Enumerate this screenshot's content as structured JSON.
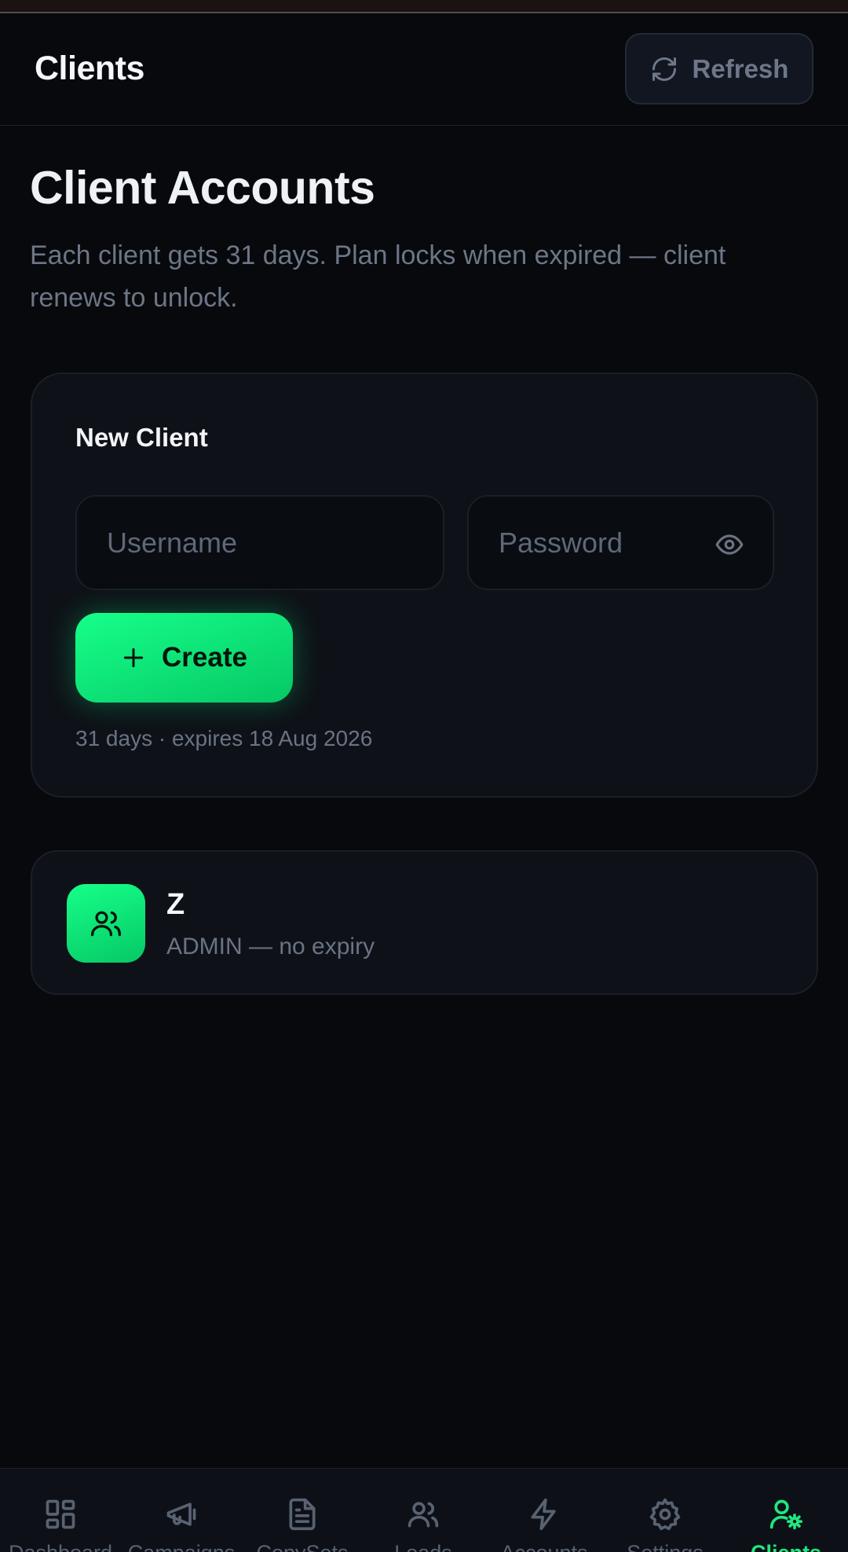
{
  "header": {
    "title": "Clients",
    "refresh_label": "Refresh"
  },
  "main": {
    "heading": "Client Accounts",
    "description": "Each client gets 31 days. Plan locks when expired — client renews to unlock."
  },
  "new_client": {
    "title": "New Client",
    "username_placeholder": "Username",
    "password_placeholder": "Password",
    "create_label": "Create",
    "meta": "31 days · expires 18 Aug 2026"
  },
  "clients": [
    {
      "name": "Z",
      "detail": "ADMIN — no expiry"
    }
  ],
  "nav": {
    "items": [
      {
        "label": "Dashboard",
        "icon": "dashboard-icon"
      },
      {
        "label": "Campaigns",
        "icon": "megaphone-icon"
      },
      {
        "label": "CopySets",
        "icon": "document-icon"
      },
      {
        "label": "Leads",
        "icon": "users-icon"
      },
      {
        "label": "Accounts",
        "icon": "lightning-icon"
      },
      {
        "label": "Settings",
        "icon": "gear-icon"
      },
      {
        "label": "Clients",
        "icon": "user-gear-icon",
        "active": true
      }
    ]
  },
  "colors": {
    "accent": "#1ee87f",
    "background": "#07090c",
    "card": "#0e1218"
  }
}
